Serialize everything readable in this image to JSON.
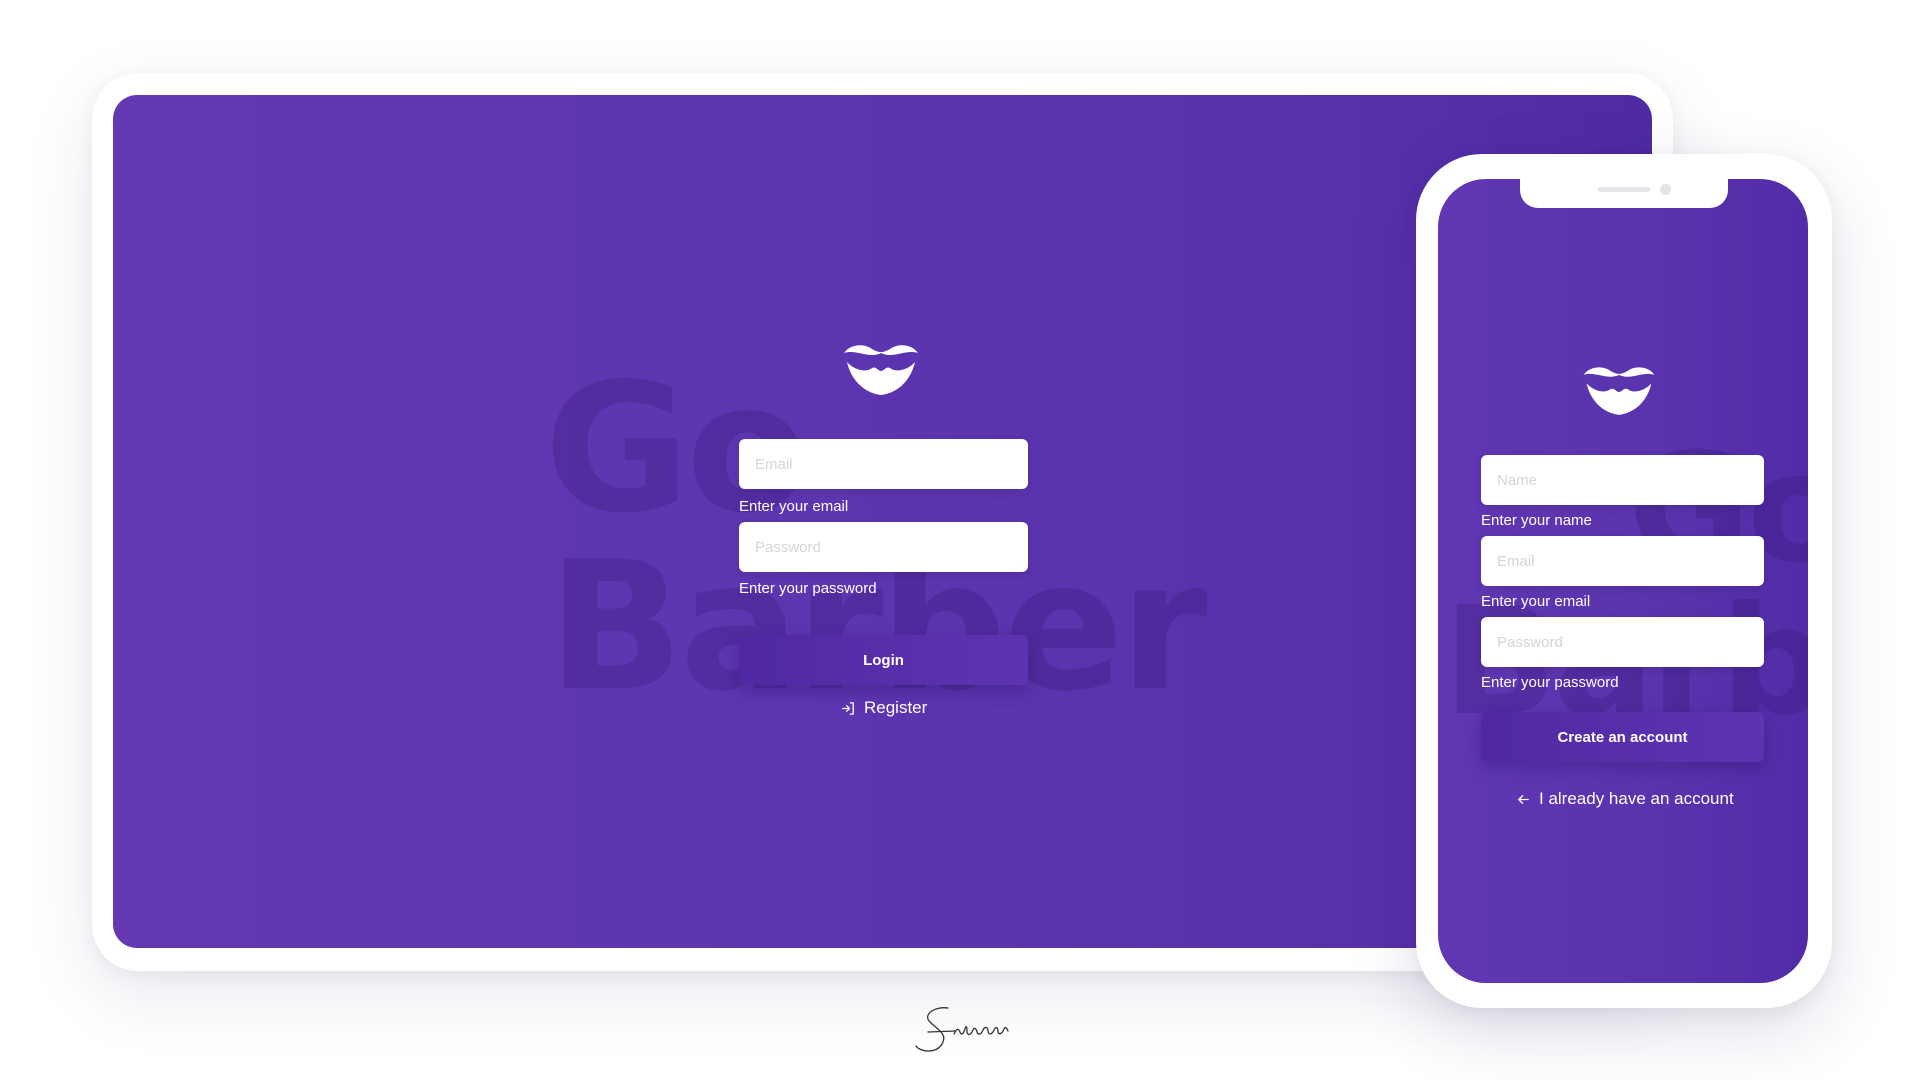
{
  "brand": {
    "background_words": [
      "Go",
      "Barber"
    ],
    "primary_color": "#5e35b1",
    "logo_icon": "mustache-logo-icon"
  },
  "desktop": {
    "email": {
      "placeholder": "Email",
      "hint": "Enter your email"
    },
    "password": {
      "placeholder": "Password",
      "hint": "Enter your password"
    },
    "login_button": "Login",
    "register_link": {
      "label": "Register",
      "icon": "log-in-icon"
    }
  },
  "mobile": {
    "name": {
      "placeholder": "Name",
      "hint": "Enter your name"
    },
    "email": {
      "placeholder": "Email",
      "hint": "Enter your email"
    },
    "password": {
      "placeholder": "Password",
      "hint": "Enter your password"
    },
    "create_button": "Create an account",
    "back_link": {
      "label": "I already have an account",
      "icon": "arrow-left-icon"
    }
  },
  "signature": {
    "icon": "signature-icon"
  }
}
